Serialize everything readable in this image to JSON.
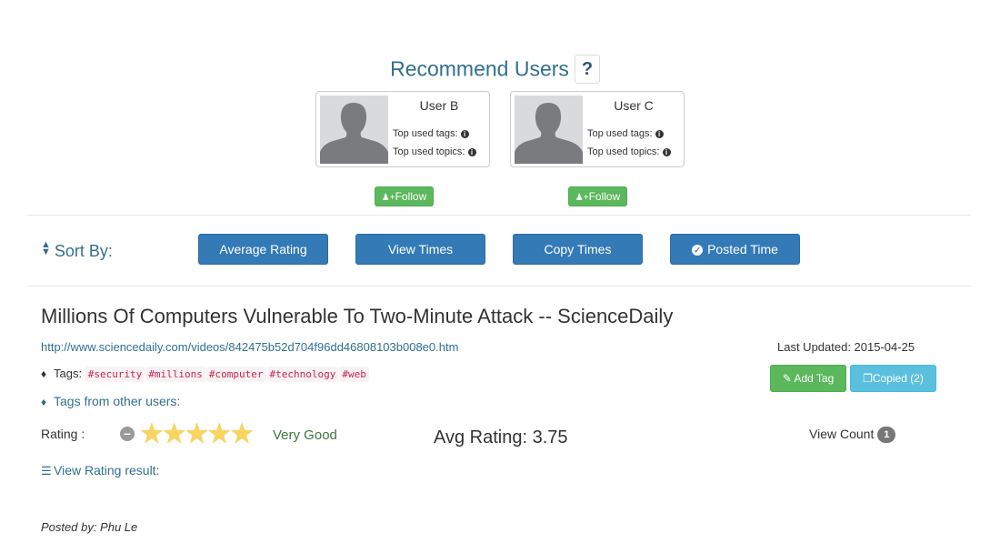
{
  "recommend": {
    "title": "Recommend Users",
    "help": "?",
    "users": [
      {
        "name": "User B",
        "tags_label": "Top used tags:",
        "topics_label": "Top used topics:",
        "follow": "Follow"
      },
      {
        "name": "User C",
        "tags_label": "Top used tags:",
        "topics_label": "Top used topics:",
        "follow": "Follow"
      }
    ]
  },
  "sort": {
    "label": "Sort By:",
    "buttons": [
      "Average Rating",
      "View Times",
      "Copy Times",
      "Posted Time"
    ],
    "active": "Posted Time"
  },
  "article": {
    "title": "Millions Of Computers Vulnerable To Two-Minute Attack -- ScienceDaily",
    "url": "http://www.sciencedaily.com/videos/842475b52d704f96dd46808103b008e0.htm",
    "last_updated": "Last Updated: 2015-04-25",
    "tags_label": "Tags:",
    "tags": [
      "#security",
      "#millions",
      "#computer",
      "#technology",
      "#web"
    ],
    "add_tag": "Add Tag",
    "copied": "Copied (2)",
    "other_tags": "Tags from other users:",
    "rating_label": "Rating :",
    "stars": 5,
    "rating_text": "Very Good",
    "avg_rating": "Avg Rating: 3.75",
    "view_count_label": "View Count",
    "view_count": "1",
    "view_rating": "View Rating result:",
    "posted_by": "Posted by: Phu Le"
  },
  "colors": {
    "primary": "#337ab7",
    "success": "#5cb85c",
    "info": "#5bc0de",
    "link": "#31708f",
    "star": "#f7d55f"
  }
}
